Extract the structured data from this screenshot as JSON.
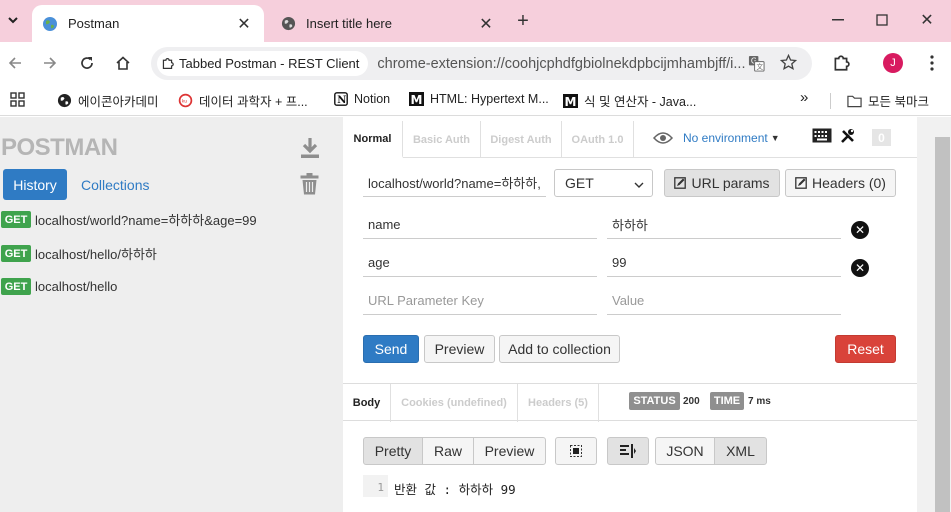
{
  "browser": {
    "tabs": [
      {
        "title": "Postman",
        "icon": "globe-colored-icon"
      },
      {
        "title": "Insert title here",
        "icon": "globe-icon"
      }
    ],
    "url_chip": "Tabbed Postman - REST Client",
    "url": "chrome-extension://coohjcphdfgbiolnekdpbcijmhambjff/i...",
    "profile_initial": "J",
    "profile_color": "#d81b60",
    "bookmarks": [
      {
        "label": "에이콘아카데미",
        "icon": "globe-icon"
      },
      {
        "label": "데이터 과학자 + 프...",
        "icon": "circle-logo-icon"
      },
      {
        "label": "Notion",
        "icon": "notion-icon"
      },
      {
        "label": "HTML: Hypertext M...",
        "icon": "mdn-icon"
      },
      {
        "label": "식 및 연산자 - Java...",
        "icon": "mdn-icon"
      }
    ],
    "all_bookmarks": "모든 북마크"
  },
  "sidebar": {
    "logo": "POSTMAN",
    "tabs": {
      "history": "History",
      "collections": "Collections"
    },
    "history": [
      {
        "method": "GET",
        "url": "localhost/world?name=하하하&age=99"
      },
      {
        "method": "GET",
        "url": "localhost/hello/하하하"
      },
      {
        "method": "GET",
        "url": "localhost/hello"
      }
    ]
  },
  "request": {
    "auth_tabs": [
      "Normal",
      "Basic Auth",
      "Digest Auth",
      "OAuth 1.0"
    ],
    "environment": "No environment",
    "env_count": "0",
    "url_value": "localhost/world?name=하하하,",
    "method": "GET",
    "url_params_label": "URL params",
    "headers_label": "Headers (0)",
    "params": [
      {
        "key": "name",
        "value": "하하하"
      },
      {
        "key": "age",
        "value": "99"
      }
    ],
    "key_placeholder": "URL Parameter Key",
    "value_placeholder": "Value",
    "send_label": "Send",
    "preview_label": "Preview",
    "add_collection_label": "Add to collection",
    "reset_label": "Reset"
  },
  "response": {
    "tabs": [
      "Body",
      "Cookies (undefined)",
      "Headers (5)"
    ],
    "status_label": "STATUS",
    "status_value": "200",
    "time_label": "TIME",
    "time_value": "7 ms",
    "view_buttons": [
      "Pretty",
      "Raw",
      "Preview"
    ],
    "format_buttons": [
      "JSON",
      "XML"
    ],
    "line_number": "1",
    "body_text": "반환 값 : 하하하 99"
  }
}
